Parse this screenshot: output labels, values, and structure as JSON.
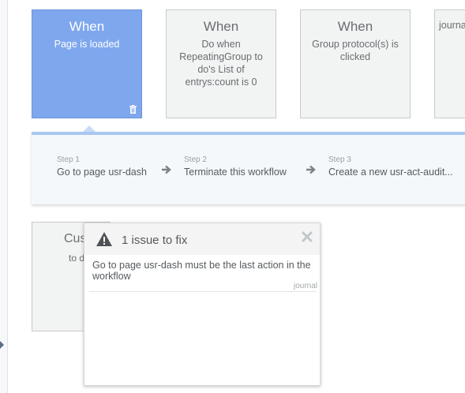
{
  "events": [
    {
      "title": "When",
      "description": "Page is loaded",
      "active": true
    },
    {
      "title": "When",
      "description": "Do when RepeatingGroup to do's List of entrys:count is 0",
      "active": false
    },
    {
      "title": "When",
      "description": "Group protocol(s) is clicked",
      "active": false
    },
    {
      "title": "",
      "description": "journa",
      "active": false
    }
  ],
  "steps": [
    {
      "number": "Step 1",
      "label": "Go to page usr-dash"
    },
    {
      "number": "Step 2",
      "label": "Terminate this workflow"
    },
    {
      "number": "Step 3",
      "label": "Create a new usr-act-audit..."
    }
  ],
  "bottom_card": {
    "title": "Cus",
    "description": "to d"
  },
  "issue_panel": {
    "title": "1 issue to fix",
    "message": "Go to page usr-dash must be the last action in the workflow",
    "source": "journal"
  },
  "icons": {
    "trash": "trash-icon",
    "warning": "warning-icon",
    "close": "close-icon",
    "arrow": "arrow-right-icon"
  },
  "colors": {
    "active_card": "#7ea7ee",
    "inactive_card": "#f2f3f3",
    "steps_accent": "#a9c7f1",
    "text": "#555a5e"
  }
}
